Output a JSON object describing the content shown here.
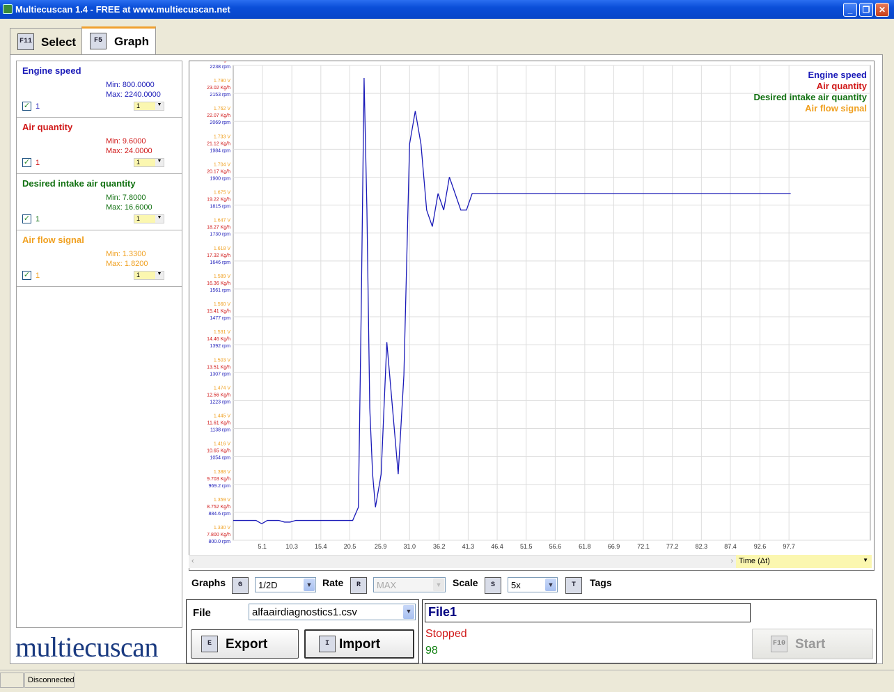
{
  "window": {
    "title": "Multiecuscan 1.4 - FREE at www.multiecuscan.net"
  },
  "tabs": [
    {
      "key": "F11",
      "label": "Select"
    },
    {
      "key": "F5",
      "label": "Graph"
    }
  ],
  "signals": [
    {
      "name": "Engine speed",
      "min": "Min: 800.0000",
      "max": "Max: 2240.0000",
      "checked": "1",
      "select": "1",
      "color": "#1a1ab8"
    },
    {
      "name": "Air quantity",
      "min": "Min: 9.6000",
      "max": "Max: 24.0000",
      "checked": "1",
      "select": "1",
      "color": "#d01818"
    },
    {
      "name": "Desired intake air quantity",
      "min": "Min: 7.8000",
      "max": "Max: 16.6000",
      "checked": "1",
      "select": "1",
      "color": "#107010"
    },
    {
      "name": "Air flow signal",
      "min": "Min: 1.3300",
      "max": "Max: 1.8200",
      "checked": "1",
      "select": "1",
      "color": "#f0a020"
    }
  ],
  "logo": "multiecuscan",
  "chart_data": {
    "type": "line",
    "x_ticks": [
      "5.1",
      "10.3",
      "15.4",
      "20.5",
      "25.9",
      "31.0",
      "36.2",
      "41.3",
      "46.4",
      "51.5",
      "56.6",
      "61.8",
      "66.9",
      "72.1",
      "77.2",
      "82.3",
      "87.4",
      "92.6",
      "97.7"
    ],
    "y_labels_volt": [
      "1.819 V",
      "1.790 V",
      "1.762 V",
      "1.733 V",
      "1.704 V",
      "1.675 V",
      "1.647 V",
      "1.618 V",
      "1.589 V",
      "1.560 V",
      "1.531 V",
      "1.503 V",
      "1.474 V",
      "1.445 V",
      "1.416 V",
      "1.388 V",
      "1.359 V",
      "1.330 V"
    ],
    "y_labels_kgh": [
      "23.98 Kg/h",
      "23.02 Kg/h",
      "22.07 Kg/h",
      "21.12 Kg/h",
      "20.17 Kg/h",
      "19.22 Kg/h",
      "18.27 Kg/h",
      "17.32 Kg/h",
      "16.36 Kg/h",
      "15.41 Kg/h",
      "14.46 Kg/h",
      "13.51 Kg/h",
      "12.56 Kg/h",
      "11.61 Kg/h",
      "10.65 Kg/h",
      "9.703 Kg/h",
      "8.752 Kg/h",
      "7.800 Kg/h"
    ],
    "y_labels_rpm": [
      "2238 rpm",
      "2153 rpm",
      "2069 rpm",
      "1984 rpm",
      "1900 rpm",
      "1815 rpm",
      "1730 rpm",
      "1646 rpm",
      "1561 rpm",
      "1477 rpm",
      "1392 rpm",
      "1307 rpm",
      "1223 rpm",
      "1138 rpm",
      "1054 rpm",
      "969.2 rpm",
      "884.6 rpm",
      "800.0 rpm"
    ],
    "series": [
      {
        "name": "Engine speed",
        "color": "#1a1ab8",
        "x": [
          0,
          2,
          4,
          5,
          6,
          7,
          8,
          9,
          10,
          11,
          12,
          13,
          14,
          15,
          16,
          17,
          18,
          19,
          20,
          21,
          22,
          22.5,
          23,
          23.5,
          24,
          24.5,
          25,
          26,
          27,
          28,
          29,
          30,
          31,
          32,
          33,
          34,
          35,
          36,
          37,
          38,
          39,
          40,
          41,
          42,
          44,
          46,
          48,
          50,
          52,
          54,
          56,
          57,
          58,
          59,
          60,
          61,
          62,
          63,
          64,
          65,
          66,
          67,
          68,
          69,
          70,
          71,
          72,
          73,
          74,
          75,
          76,
          77,
          78,
          79,
          80,
          81,
          82,
          83,
          84,
          85,
          86,
          87,
          88,
          89,
          90,
          91,
          92,
          93,
          94,
          95,
          96,
          97,
          98
        ],
        "y": [
          860,
          860,
          860,
          850,
          860,
          860,
          860,
          855,
          855,
          860,
          860,
          860,
          860,
          860,
          860,
          860,
          860,
          860,
          860,
          860,
          900,
          1500,
          2200,
          1800,
          1200,
          1000,
          900,
          1000,
          1400,
          1200,
          1000,
          1300,
          2000,
          2100,
          2000,
          1800,
          1750,
          1850,
          1800,
          1900,
          1850,
          1800,
          1800,
          1850,
          1850,
          1850,
          1850,
          1850,
          1850,
          1850,
          1850,
          1850,
          1850,
          1850,
          1850,
          1850,
          1850,
          1850,
          1850,
          1850,
          1850,
          1850,
          1850,
          1850,
          1850,
          1850,
          1850,
          1850,
          1850,
          1850,
          1850,
          1850,
          1850,
          1850,
          1850,
          1850,
          1850,
          1850,
          1850,
          1850,
          1850,
          1850,
          1850,
          1850,
          1850,
          1850,
          1850,
          1850,
          1850,
          1850,
          1850,
          1850,
          1850
        ]
      }
    ]
  },
  "legend": [
    "Engine speed",
    "Air quantity",
    "Desired intake air quantity",
    "Air flow signal"
  ],
  "time_select": "Time (Δt)",
  "controls": {
    "graphs_label": "Graphs",
    "graphs_key": "G",
    "graphs_value": "1/2D",
    "rate_label": "Rate",
    "rate_key": "R",
    "rate_value": "MAX",
    "scale_label": "Scale",
    "scale_key": "S",
    "scale_value": "5x",
    "tags_key": "T",
    "tags_label": "Tags"
  },
  "file": {
    "label": "File",
    "value": "alfaairdiagnostics1.csv",
    "export_key": "E",
    "export_label": "Export",
    "import_key": "I",
    "import_label": "Import"
  },
  "status": {
    "name": "File1",
    "state": "Stopped",
    "count": "98",
    "start_key": "F10",
    "start_label": "Start"
  },
  "statusbar": {
    "connection": "Disconnected"
  }
}
